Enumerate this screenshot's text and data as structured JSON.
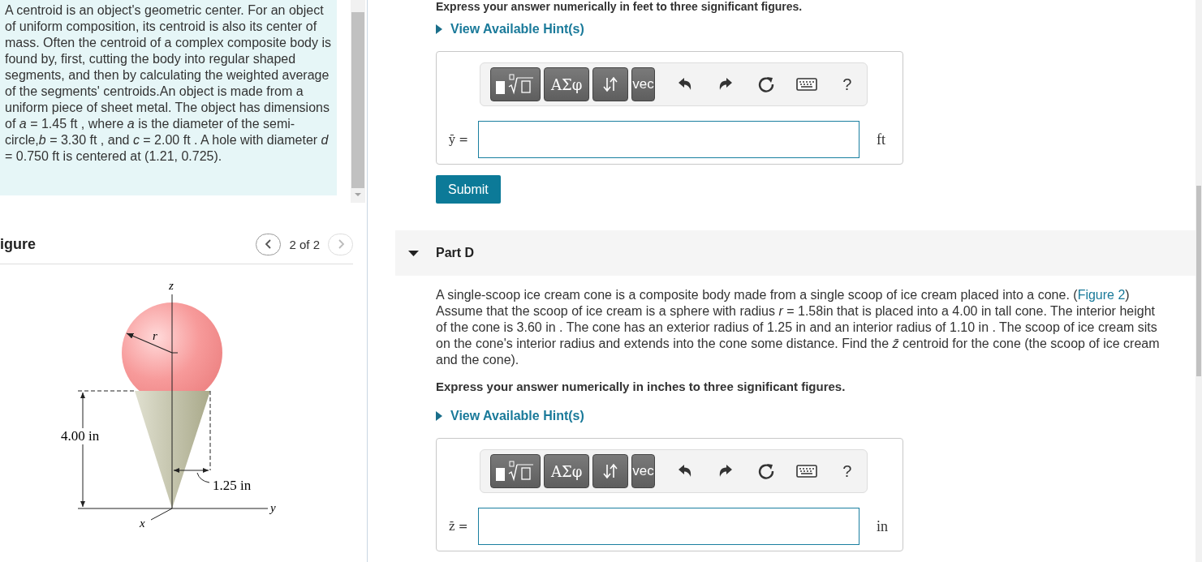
{
  "intro_text": "A centroid is an object's geometric center. For an object of uniform composition, its centroid is also its center of mass. Often the centroid of a complex composite body is found by, first, cutting the body into regular shaped segments, and then by calculating the weighted average of the segments' centroids.An object is made from a uniform piece of sheet metal. The object has dimensions of *a* = 1.45 ft , where *a* is the diameter of the semi-circle,*b* = 3.30 ft , and *c* = 2.00 ft . A hole with diameter *d* = 0.750 ft is centered at (1.21, 0.725).",
  "figure_panel": {
    "title": "igure",
    "pager": {
      "position": "2 of 2",
      "prev_disabled": false,
      "next_disabled": true
    },
    "labels": {
      "z_axis": "z",
      "radius": "r",
      "height": "4.00 in",
      "cone_radius": "1.25 in",
      "y_axis": "y",
      "x_axis": "x"
    }
  },
  "part_c": {
    "instruction": "Express your answer numerically in feet to three significant figures.",
    "hint": "View Available Hint(s)",
    "answer": {
      "variable": "ȳ =",
      "unit": "ft",
      "toolbar": [
        {
          "kind": "template"
        },
        {
          "kind": "text",
          "label": "ΑΣφ"
        },
        {
          "kind": "updown"
        },
        {
          "kind": "text",
          "label": "vec"
        },
        {
          "kind": "undo"
        },
        {
          "kind": "redo"
        },
        {
          "kind": "reset"
        },
        {
          "kind": "keyboard"
        },
        {
          "kind": "plain",
          "label": "?"
        }
      ]
    },
    "submit": "Submit"
  },
  "part_d": {
    "title": "Part D",
    "expanded": true,
    "text_before_link": "A single-scoop ice cream cone is a composite body made from a single scoop of ice cream placed into a cone. (",
    "link": "Figure 2",
    "text_after_link": ")",
    "text_continued": "Assume that the scoop of ice cream is a sphere with radius *r* = 1.58in that is placed into a 4.00 in tall cone. The interior height of the cone is 3.60 in . The cone has an exterior radius of 1.25 in and an interior radius of 1.10 in . The scoop of ice cream sits on the cone's interior radius and extends into the cone some distance. Find the *z̄* centroid for the cone (the scoop of ice cream and the cone).",
    "instruction": "Express your answer numerically in inches to three significant figures.",
    "hint": "View Available Hint(s)",
    "answer": {
      "variable": "z̄ =",
      "unit": "in",
      "toolbar": [
        {
          "kind": "template"
        },
        {
          "kind": "text",
          "label": "ΑΣφ"
        },
        {
          "kind": "updown"
        },
        {
          "kind": "text",
          "label": "vec"
        },
        {
          "kind": "undo"
        },
        {
          "kind": "redo"
        },
        {
          "kind": "reset"
        },
        {
          "kind": "keyboard"
        },
        {
          "kind": "plain",
          "label": "?"
        }
      ]
    }
  }
}
